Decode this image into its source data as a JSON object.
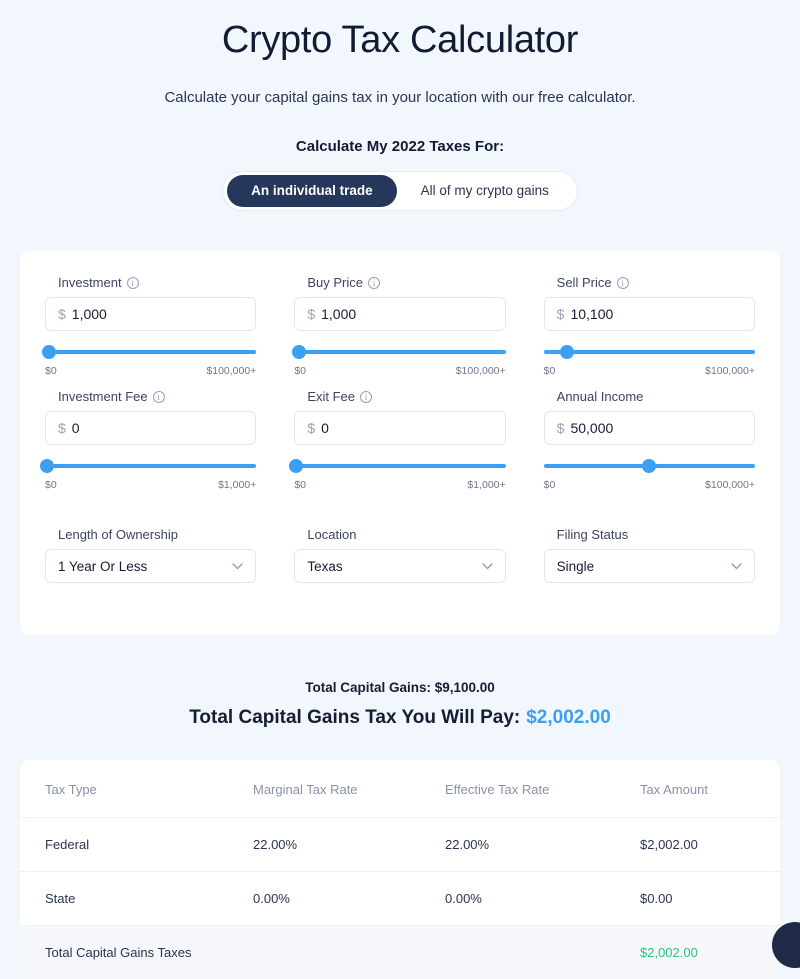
{
  "header": {
    "title": "Crypto Tax Calculator",
    "subtitle": "Calculate your capital gains tax in your location with our free calculator.",
    "mode_label": "Calculate My 2022 Taxes For:"
  },
  "toggle": {
    "options": [
      {
        "label": "An individual trade",
        "active": true
      },
      {
        "label": "All of my crypto gains",
        "active": false
      }
    ]
  },
  "form": {
    "fields": [
      {
        "label": "Investment",
        "has_info_icon": true,
        "currency": "$",
        "value": "1,000",
        "slider_percent": 2,
        "range_min": "$0",
        "range_max": "$100,000+"
      },
      {
        "label": "Buy Price",
        "has_info_icon": true,
        "currency": "$",
        "value": "1,000",
        "slider_percent": 2,
        "range_min": "$0",
        "range_max": "$100,000+"
      },
      {
        "label": "Sell Price",
        "has_info_icon": true,
        "currency": "$",
        "value": "10,100",
        "slider_percent": 11,
        "range_min": "$0",
        "range_max": "$100,000+"
      },
      {
        "label": "Investment Fee",
        "has_info_icon": true,
        "currency": "$",
        "value": "0",
        "slider_percent": 1,
        "range_min": "$0",
        "range_max": "$1,000+"
      },
      {
        "label": "Exit Fee",
        "has_info_icon": true,
        "currency": "$",
        "value": "0",
        "slider_percent": 1,
        "range_min": "$0",
        "range_max": "$1,000+"
      },
      {
        "label": "Annual Income",
        "has_info_icon": false,
        "currency": "$",
        "value": "50,000",
        "slider_percent": 50,
        "range_min": "$0",
        "range_max": "$100,000+"
      }
    ],
    "selects": [
      {
        "label": "Length of Ownership",
        "value": "1 Year Or Less",
        "icon": "chevron-down-icon"
      },
      {
        "label": "Location",
        "value": "Texas",
        "icon": "chevron-down-icon"
      },
      {
        "label": "Filing Status",
        "value": "Single",
        "icon": "chevron-down-icon"
      }
    ]
  },
  "results": {
    "total_gains_line": "Total Capital Gains: $9,100.00",
    "total_tax_label": "Total Capital Gains Tax You Will Pay:",
    "total_tax_amount": "$2,002.00"
  },
  "table": {
    "headers": [
      "Tax Type",
      "Marginal Tax Rate",
      "Effective Tax Rate",
      "Tax Amount"
    ],
    "rows": [
      {
        "tax_type": "Federal",
        "marginal": "22.00%",
        "effective": "22.00%",
        "amount": "$2,002.00"
      },
      {
        "tax_type": "State",
        "marginal": "0.00%",
        "effective": "0.00%",
        "amount": "$0.00"
      }
    ],
    "total_row": {
      "tax_type": "Total Capital Gains Taxes",
      "marginal": "",
      "effective": "",
      "amount": "$2,002.00"
    }
  },
  "colors": {
    "page_bg": "#f1f7fd",
    "accent_blue": "#3ba0f4",
    "dark_navy": "#26375c",
    "green": "#32c07a"
  }
}
